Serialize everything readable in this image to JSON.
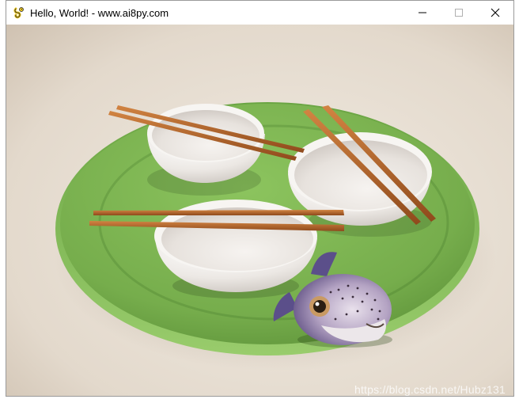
{
  "window": {
    "title": "Hello, World! - www.ai8py.com",
    "icons": {
      "app": "pygame-snake-icon",
      "minimize": "minimize-icon",
      "maximize": "maximize-icon",
      "close": "close-icon"
    }
  },
  "scene": {
    "description_items": [
      "green-plate",
      "rice-bowls",
      "chopsticks",
      "pufferfish"
    ],
    "colors": {
      "background": "#e6ddd1",
      "plate": "#7db356",
      "bowl": "#f2efec",
      "chopsticks": "#b5652a",
      "fish": "#9a8bb8"
    }
  },
  "watermark": "https://blog.csdn.net/Hubz131"
}
